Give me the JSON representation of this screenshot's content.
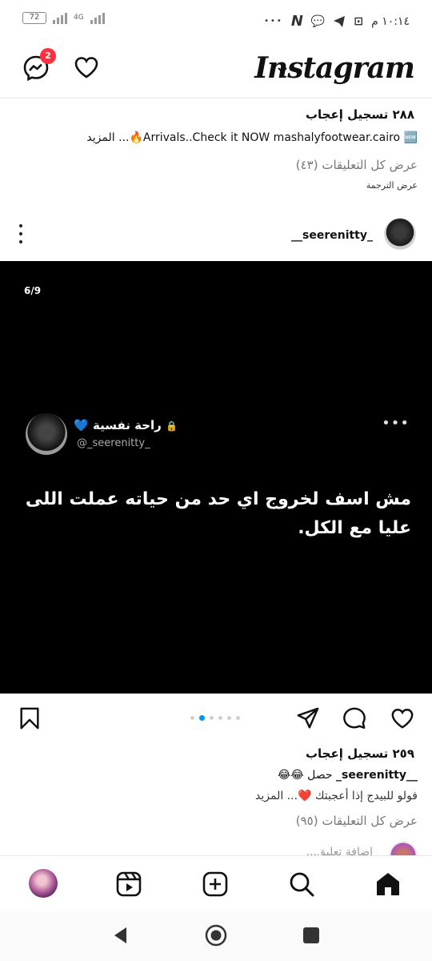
{
  "status_bar": {
    "battery": "72",
    "network": "4G",
    "time": "١٠:١٤ م",
    "more": "•••",
    "app_icon_n": "N"
  },
  "header": {
    "logo": "Instagram",
    "messenger_badge": "2",
    "icons": [
      "chevron-down-icon",
      "messenger-icon",
      "heart-icon"
    ]
  },
  "previous_post": {
    "likes": "٢٨٨ تسجيل إعجاب",
    "caption": "Arrivals..Check it NOW mashalyfootwear.cairo 🆕🔥... المزيد",
    "view_comments": "عرض كل التعليقات (٤٣)",
    "translate": "عرض الترجمة"
  },
  "post": {
    "username": "__seerenitty_",
    "page_counter": "6/9",
    "tweet": {
      "name": "راحة نفسية 💙",
      "handle": "@_seerenitty_",
      "menu": "•••",
      "text": "مش اسف لخروج اي حد من حياته عملت اللى عليا مع الكل."
    },
    "carousel": {
      "total": 6,
      "active": 1
    },
    "likes": "٢٥٩ تسجيل إعجاب",
    "caption_user": "__seerenitty_",
    "caption_text": "حصل 😂😂",
    "caption_line2": "فولو للبيدج إذا أعجبتك ❤️... المزيد",
    "view_comments": "عرض كل التعليقات (٩٥)",
    "add_comment": "إضافة تعليق..."
  },
  "colors": {
    "accent": "#0095f6",
    "badge": "#ff3040",
    "image_bg": "#000000"
  }
}
